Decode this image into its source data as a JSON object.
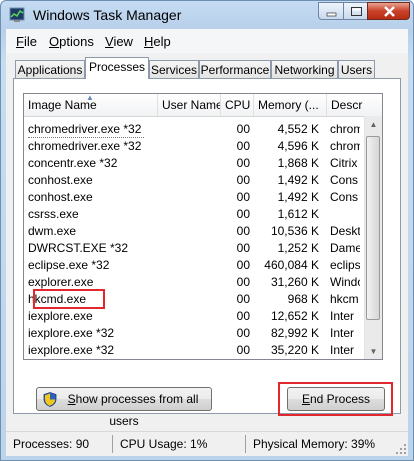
{
  "window": {
    "title": "Windows Task Manager"
  },
  "menu": [
    {
      "mnemonic": "F",
      "rest": "ile"
    },
    {
      "mnemonic": "O",
      "rest": "ptions"
    },
    {
      "mnemonic": "V",
      "rest": "iew"
    },
    {
      "mnemonic": "H",
      "rest": "elp"
    }
  ],
  "tabs": [
    "Applications",
    "Processes",
    "Services",
    "Performance",
    "Networking",
    "Users"
  ],
  "active_tab": "Processes",
  "columns": [
    "Image Name",
    "User Name",
    "CPU",
    "Memory (...",
    "Descr"
  ],
  "rows": [
    {
      "name": "chromedriver.exe *32",
      "user": "",
      "cpu": "00",
      "mem": "4,552 K",
      "desc": "chrom"
    },
    {
      "name": "chromedriver.exe *32",
      "user": "",
      "cpu": "00",
      "mem": "4,596 K",
      "desc": "chrom"
    },
    {
      "name": "concentr.exe *32",
      "user": "",
      "cpu": "00",
      "mem": "1,868 K",
      "desc": "Citrix"
    },
    {
      "name": "conhost.exe",
      "user": "",
      "cpu": "00",
      "mem": "1,492 K",
      "desc": "Cons"
    },
    {
      "name": "conhost.exe",
      "user": "",
      "cpu": "00",
      "mem": "1,492 K",
      "desc": "Cons"
    },
    {
      "name": "csrss.exe",
      "user": "",
      "cpu": "00",
      "mem": "1,612 K",
      "desc": ""
    },
    {
      "name": "dwm.exe",
      "user": "",
      "cpu": "00",
      "mem": "10,536 K",
      "desc": "Deskt"
    },
    {
      "name": "DWRCST.EXE *32",
      "user": "",
      "cpu": "00",
      "mem": "1,252 K",
      "desc": "Dame"
    },
    {
      "name": "eclipse.exe *32",
      "user": "",
      "cpu": "00",
      "mem": "460,084 K",
      "desc": "eclips"
    },
    {
      "name": "explorer.exe",
      "user": "",
      "cpu": "00",
      "mem": "31,260 K",
      "desc": "Windo"
    },
    {
      "name": "hkcmd.exe",
      "user": "",
      "cpu": "00",
      "mem": "968 K",
      "desc": "hkcm"
    },
    {
      "name": "iexplore.exe",
      "user": "",
      "cpu": "00",
      "mem": "12,652 K",
      "desc": "Inter"
    },
    {
      "name": "iexplore.exe *32",
      "user": "",
      "cpu": "00",
      "mem": "82,992 K",
      "desc": "Inter"
    },
    {
      "name": "iexplore.exe *32",
      "user": "",
      "cpu": "00",
      "mem": "35,220 K",
      "desc": "Inter"
    }
  ],
  "buttons": {
    "show_all": {
      "mnemonic": "S",
      "rest": "how processes from all users"
    },
    "end_process": {
      "mnemonic": "E",
      "rest": "nd Process"
    }
  },
  "status": {
    "processes": "Processes: 90",
    "cpu": "CPU Usage: 1%",
    "memory": "Physical Memory: 39%"
  },
  "colors": {
    "highlight_box": "#e0282e",
    "close_button": "#c9412a"
  },
  "icons": [
    "task-manager-icon",
    "minimize-icon",
    "maximize-icon",
    "close-icon",
    "sort-ascending-icon",
    "scroll-up-icon",
    "scroll-down-icon",
    "uac-shield-icon",
    "resize-grip-icon"
  ]
}
